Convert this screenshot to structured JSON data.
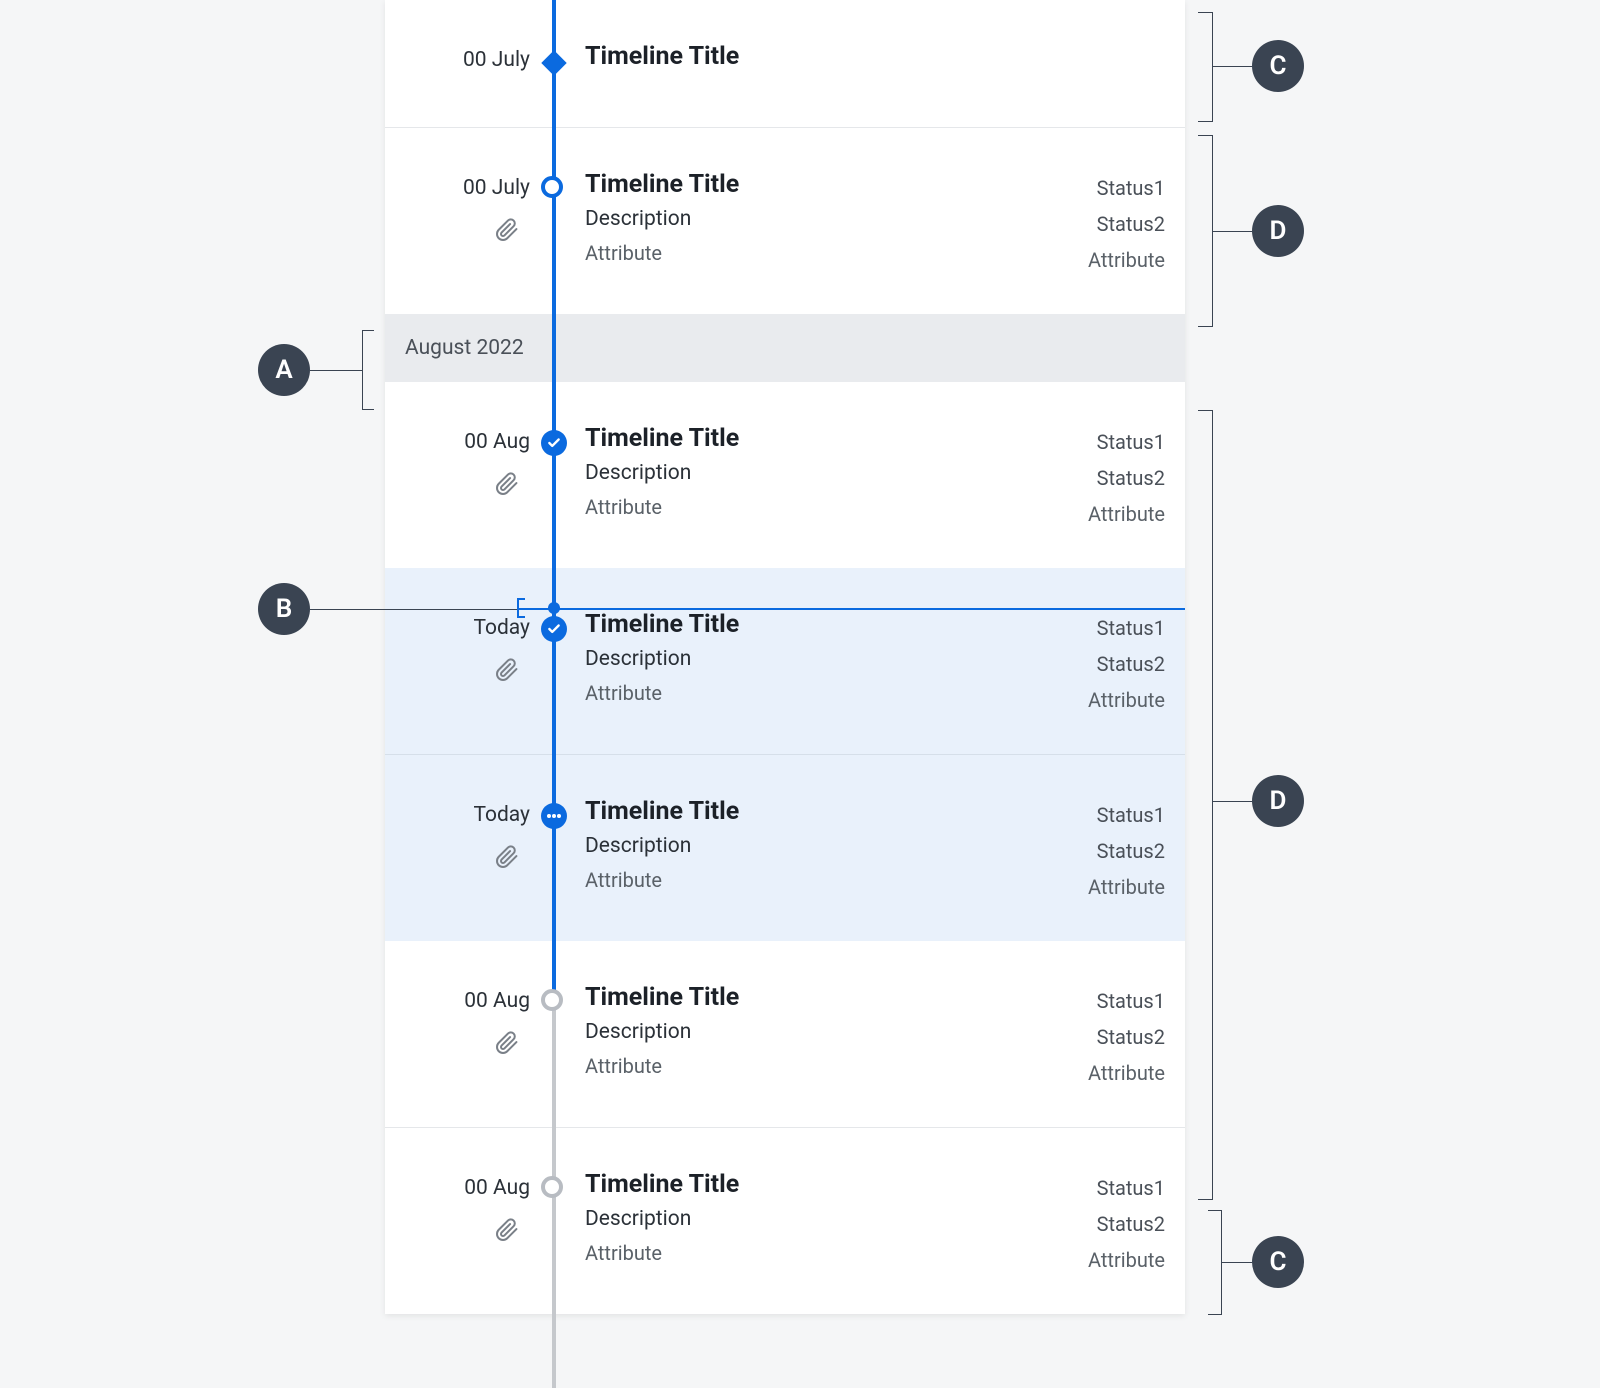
{
  "colors": {
    "brand_blue": "#0b6adf",
    "badge_bg": "#3a4452",
    "line_gray": "#b8bcc2"
  },
  "annotations": {
    "a": "A",
    "b": "B",
    "c": "C",
    "d": "D"
  },
  "group_header": "August 2022",
  "entries": [
    {
      "date": "00 July",
      "title": "Timeline Title",
      "node": "diamond",
      "has_attach": false,
      "icon_name": "diamond-icon"
    },
    {
      "date": "00 July",
      "title": "Timeline Title",
      "description": "Description",
      "attribute_left": "Attribute",
      "attribute_right": "Attribute",
      "status1": "Status1",
      "status2": "Status2",
      "node": "open",
      "has_attach": true,
      "icon_name": "circle-open-icon"
    },
    {
      "date": "00 Aug",
      "title": "Timeline Title",
      "description": "Description",
      "attribute_left": "Attribute",
      "attribute_right": "Attribute",
      "status1": "Status1",
      "status2": "Status2",
      "node": "check",
      "has_attach": true,
      "icon_name": "check-circle-icon"
    },
    {
      "date": "Today",
      "title": "Timeline Title",
      "description": "Description",
      "attribute_left": "Attribute",
      "attribute_right": "Attribute",
      "status1": "Status1",
      "status2": "Status2",
      "node": "check",
      "has_attach": true,
      "highlight": true,
      "icon_name": "check-circle-icon"
    },
    {
      "date": "Today",
      "title": "Timeline Title",
      "description": "Description",
      "attribute_left": "Attribute",
      "attribute_right": "Attribute",
      "status1": "Status1",
      "status2": "Status2",
      "node": "dots",
      "has_attach": true,
      "highlight": true,
      "icon_name": "dots-circle-icon"
    },
    {
      "date": "00 Aug",
      "title": "Timeline Title",
      "description": "Description",
      "attribute_left": "Attribute",
      "attribute_right": "Attribute",
      "status1": "Status1",
      "status2": "Status2",
      "node": "open-gray",
      "has_attach": true,
      "icon_name": "circle-open-gray-icon"
    },
    {
      "date": "00 Aug",
      "title": "Timeline Title",
      "description": "Description",
      "attribute_left": "Attribute",
      "attribute_right": "Attribute",
      "status1": "Status1",
      "status2": "Status2",
      "node": "open-gray",
      "has_attach": true,
      "icon_name": "circle-open-gray-icon"
    }
  ]
}
